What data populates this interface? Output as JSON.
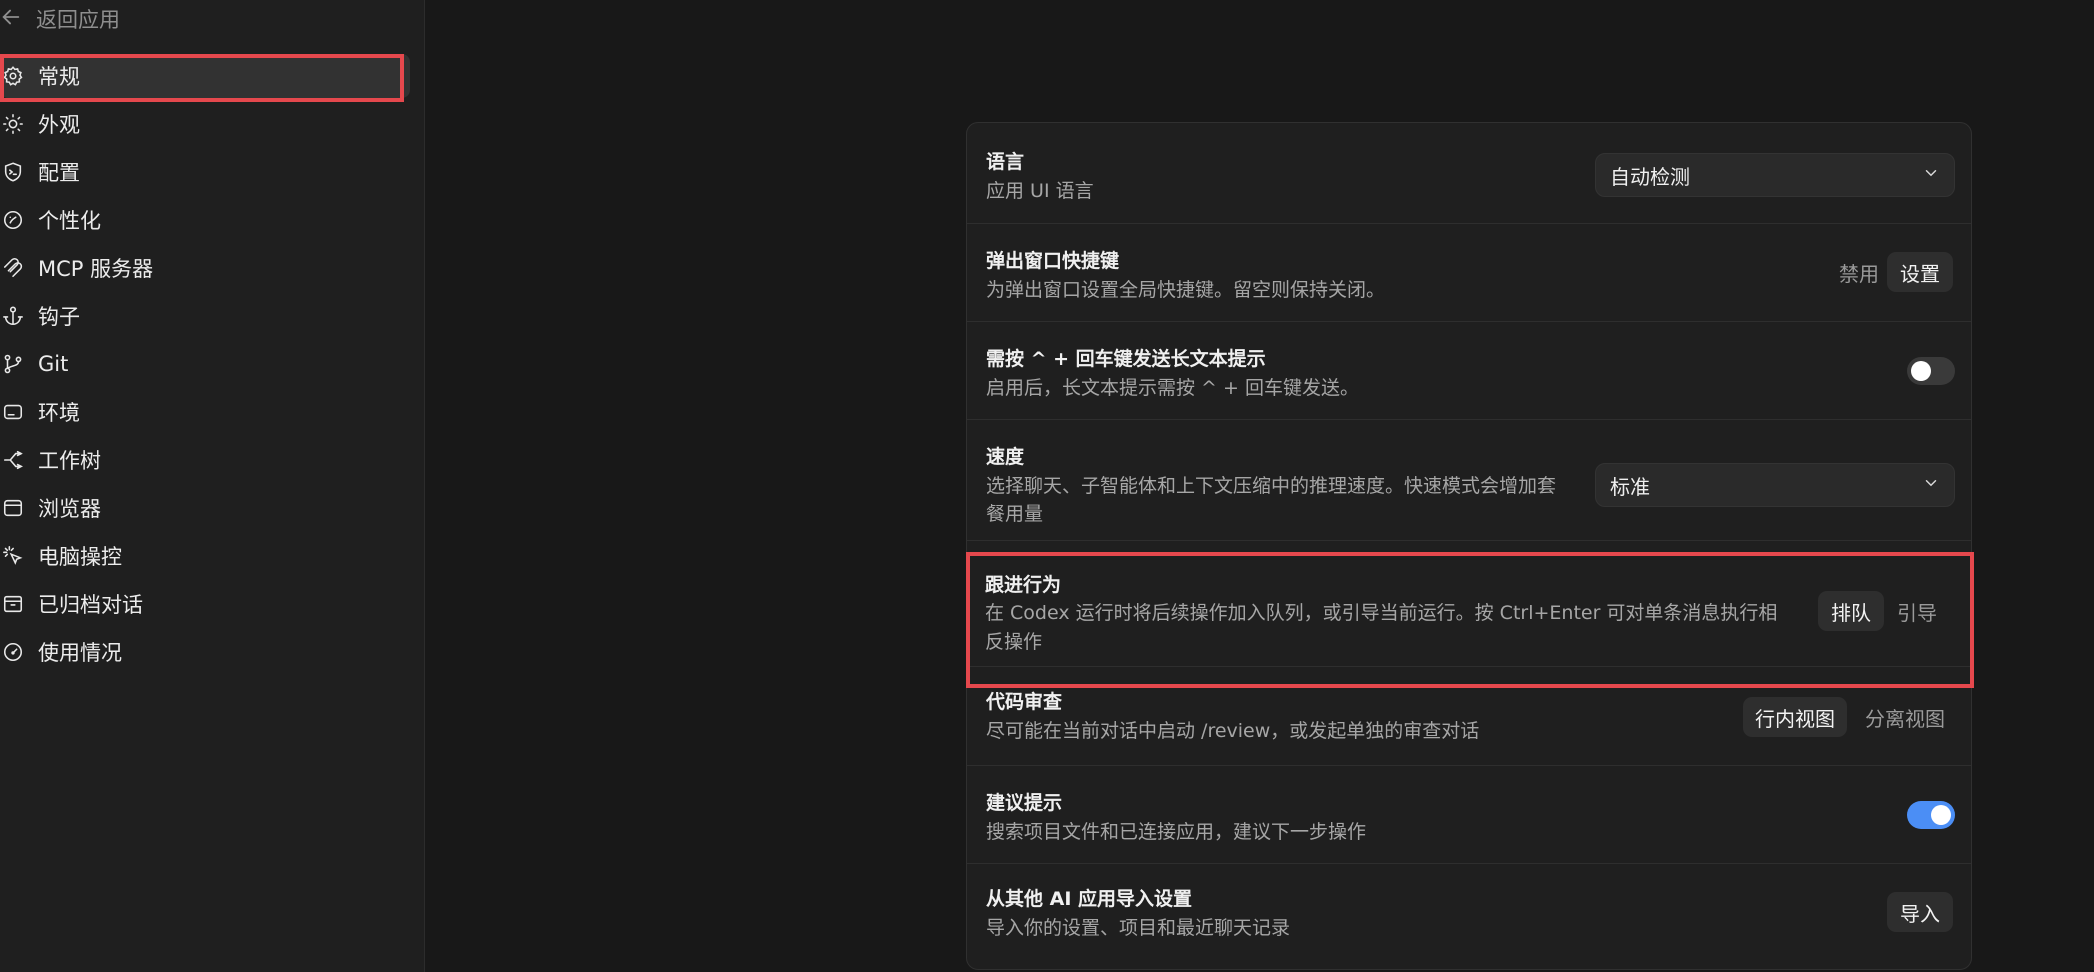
{
  "sidebar": {
    "back_label": "返回应用",
    "items": [
      {
        "label": "常规",
        "icon": "gear-icon"
      },
      {
        "label": "外观",
        "icon": "sun-icon"
      },
      {
        "label": "配置",
        "icon": "shield-terminal-icon"
      },
      {
        "label": "个性化",
        "icon": "personalize-icon"
      },
      {
        "label": "MCP 服务器",
        "icon": "mcp-icon"
      },
      {
        "label": "钩子",
        "icon": "anchor-icon"
      },
      {
        "label": "Git",
        "icon": "git-branch-icon"
      },
      {
        "label": "环境",
        "icon": "environment-icon"
      },
      {
        "label": "工作树",
        "icon": "worktree-icon"
      },
      {
        "label": "浏览器",
        "icon": "browser-icon"
      },
      {
        "label": "电脑操控",
        "icon": "cursor-click-icon"
      },
      {
        "label": "已归档对话",
        "icon": "archive-icon"
      },
      {
        "label": "使用情况",
        "icon": "gauge-icon"
      }
    ],
    "active_index": 0
  },
  "settings": {
    "language": {
      "title": "语言",
      "desc": "应用 UI 语言",
      "value": "自动检测"
    },
    "popup_shortcut": {
      "title": "弹出窗口快捷键",
      "desc": "为弹出窗口设置全局快捷键。留空则保持关闭。",
      "disable_label": "禁用",
      "set_label": "设置"
    },
    "long_text_send": {
      "title": "需按 ^ + 回车键发送长文本提示",
      "desc": "启用后，长文本提示需按 ^ + 回车键发送。",
      "enabled": false
    },
    "speed": {
      "title": "速度",
      "desc_line1": "选择聊天、子智能体和上下文压缩中的推理速度。快速模式会增加套",
      "desc_line2": "餐用量",
      "value": "标准"
    },
    "follow_up": {
      "title": "跟进行为",
      "desc_line1": "在 Codex 运行时将后续操作加入队列，或引导当前运行。按 Ctrl+Enter 可对单条消息执行相",
      "desc_line2": "反操作",
      "option_queue": "排队",
      "option_steer": "引导",
      "selected": "排队"
    },
    "code_review": {
      "title": "代码审查",
      "desc": "尽可能在当前对话中启动 /review，或发起单独的审查对话",
      "option_inline": "行内视图",
      "option_split": "分离视图",
      "selected": "行内视图"
    },
    "suggestions": {
      "title": "建议提示",
      "desc": "搜索项目文件和已连接应用，建议下一步操作",
      "enabled": true
    },
    "import": {
      "title": "从其他 AI 应用导入设置",
      "desc": "导入你的设置、项目和最近聊天记录",
      "button": "导入"
    }
  },
  "colors": {
    "highlight": "#e5484d",
    "toggle_on": "#4b8ef5",
    "background": "#181818"
  }
}
